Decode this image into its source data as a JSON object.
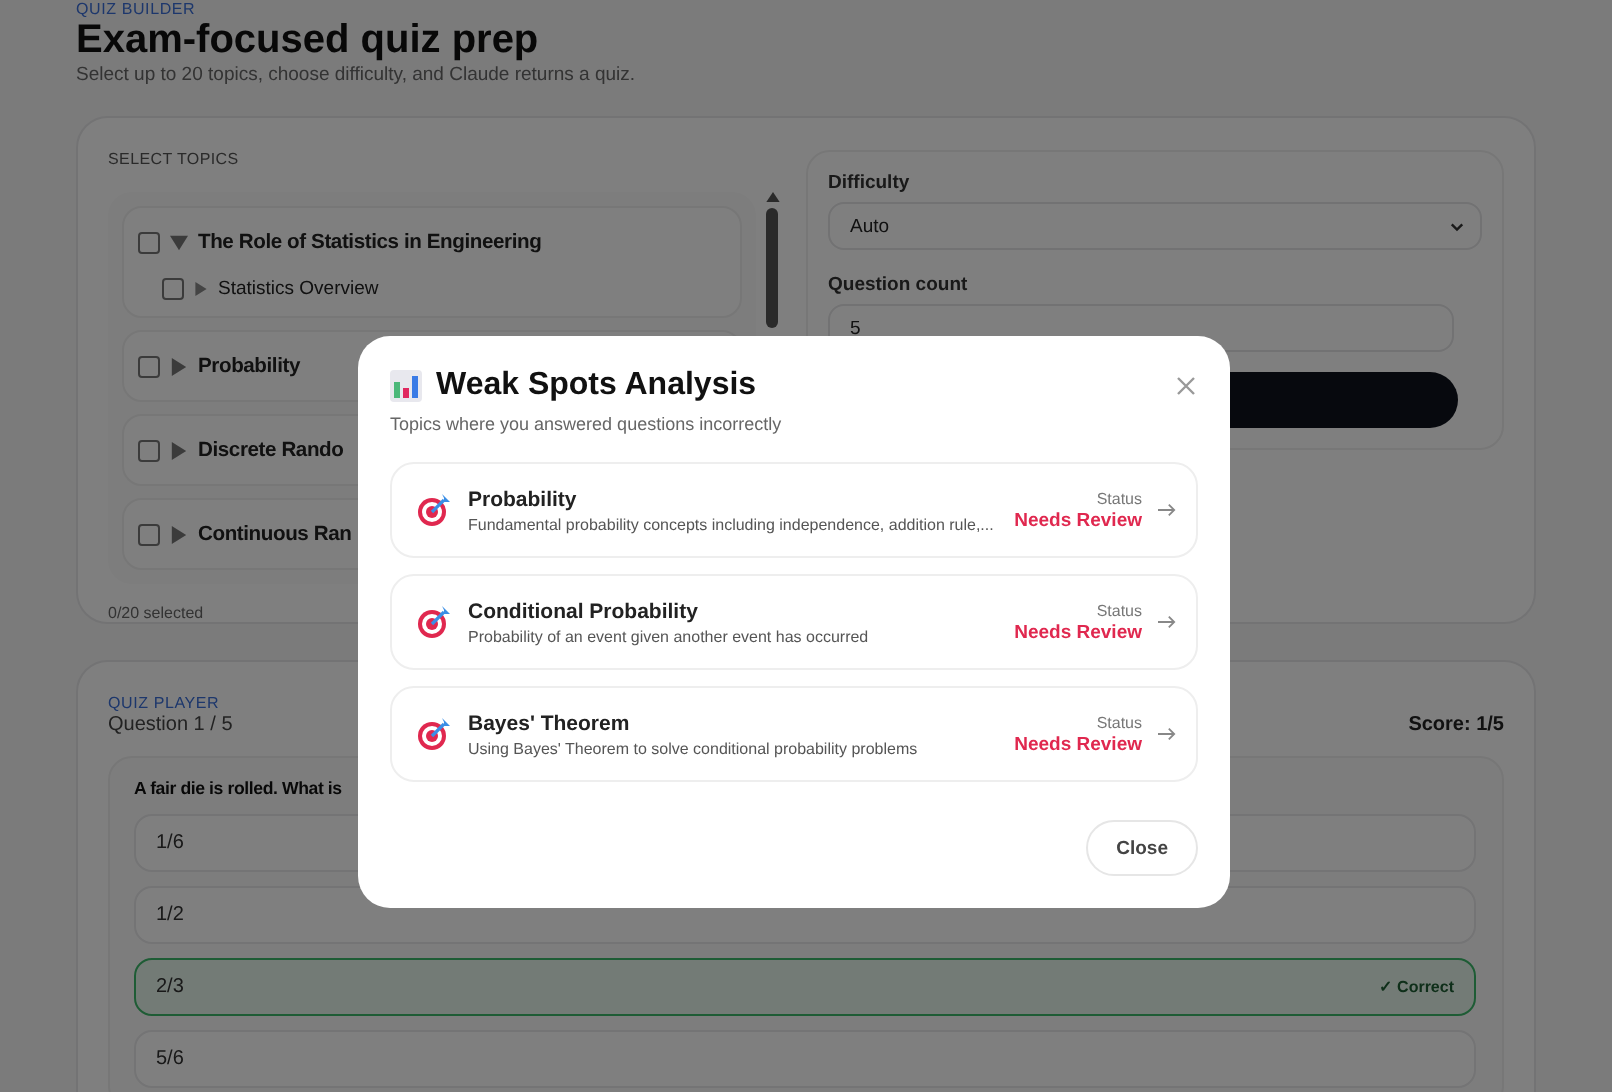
{
  "header": {
    "eyebrow": "QUIZ BUILDER",
    "title": "Exam-focused quiz prep",
    "subtitle": "Select up to 20 topics, choose difficulty, and Claude returns a quiz."
  },
  "topics": {
    "label": "SELECT TOPICS",
    "selected_count": "0/20 selected",
    "items": [
      {
        "label": "The Role of Statistics in Engineering",
        "checked": false,
        "expanded": true,
        "children": [
          {
            "label": "Statistics Overview",
            "checked": false,
            "expanded": false
          }
        ]
      },
      {
        "label": "Probability",
        "checked": false,
        "expanded": false
      },
      {
        "label": "Discrete Rando",
        "checked": false,
        "expanded": false
      },
      {
        "label": "Continuous Ran",
        "checked": false,
        "expanded": false
      }
    ]
  },
  "settings": {
    "difficulty_label": "Difficulty",
    "difficulty": "Auto",
    "count_label": "Question count",
    "count": "5"
  },
  "player": {
    "eyebrow": "QUIZ PLAYER",
    "progress": "Question 1 / 5",
    "score": "Score: 1/5",
    "question": "A fair die is rolled. What is",
    "correct_label": "✓ Correct",
    "options": [
      {
        "text": "1/6",
        "correct": false
      },
      {
        "text": "1/2",
        "correct": false
      },
      {
        "text": "2/3",
        "correct": true
      },
      {
        "text": "5/6",
        "correct": false
      }
    ]
  },
  "modal": {
    "title": "Weak Spots Analysis",
    "subtitle": "Topics where you answered questions incorrectly",
    "close": "Close",
    "items": [
      {
        "name": "Probability",
        "description": "Fundamental probability concepts including independence, addition rule,...",
        "status_label": "Status",
        "status": "Needs Review"
      },
      {
        "name": "Conditional Probability",
        "description": "Probability of an event given another event has occurred",
        "status_label": "Status",
        "status": "Needs Review"
      },
      {
        "name": "Bayes' Theorem",
        "description": "Using Bayes' Theorem to solve conditional probability problems",
        "status_label": "Status",
        "status": "Needs Review"
      }
    ]
  }
}
